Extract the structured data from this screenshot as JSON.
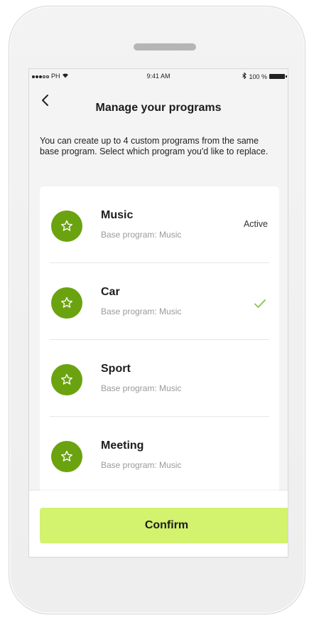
{
  "status_bar": {
    "carrier": "PH",
    "time": "9:41 AM",
    "battery": "100 %"
  },
  "header": {
    "back_icon": "chevron-left-icon",
    "title": "Manage your programs"
  },
  "intro": "You can create up to 4 custom programs from the same base program. Select which program you'd like to replace.",
  "programs": [
    {
      "name": "Music",
      "base": "Base program: Music",
      "status": "Active",
      "icon": "star-icon"
    },
    {
      "name": "Car",
      "base": "Base program: Music",
      "status": "selected",
      "icon": "star-icon"
    },
    {
      "name": "Sport",
      "base": "Base program: Music",
      "icon": "star-icon"
    },
    {
      "name": "Meeting",
      "base": "Base program: Music",
      "icon": "star-icon"
    }
  ],
  "footer": {
    "confirm_label": "Confirm"
  },
  "colors": {
    "accent_green": "#6aa30f",
    "confirm_bg": "#d3f26d",
    "check_green": "#8bc34a"
  }
}
